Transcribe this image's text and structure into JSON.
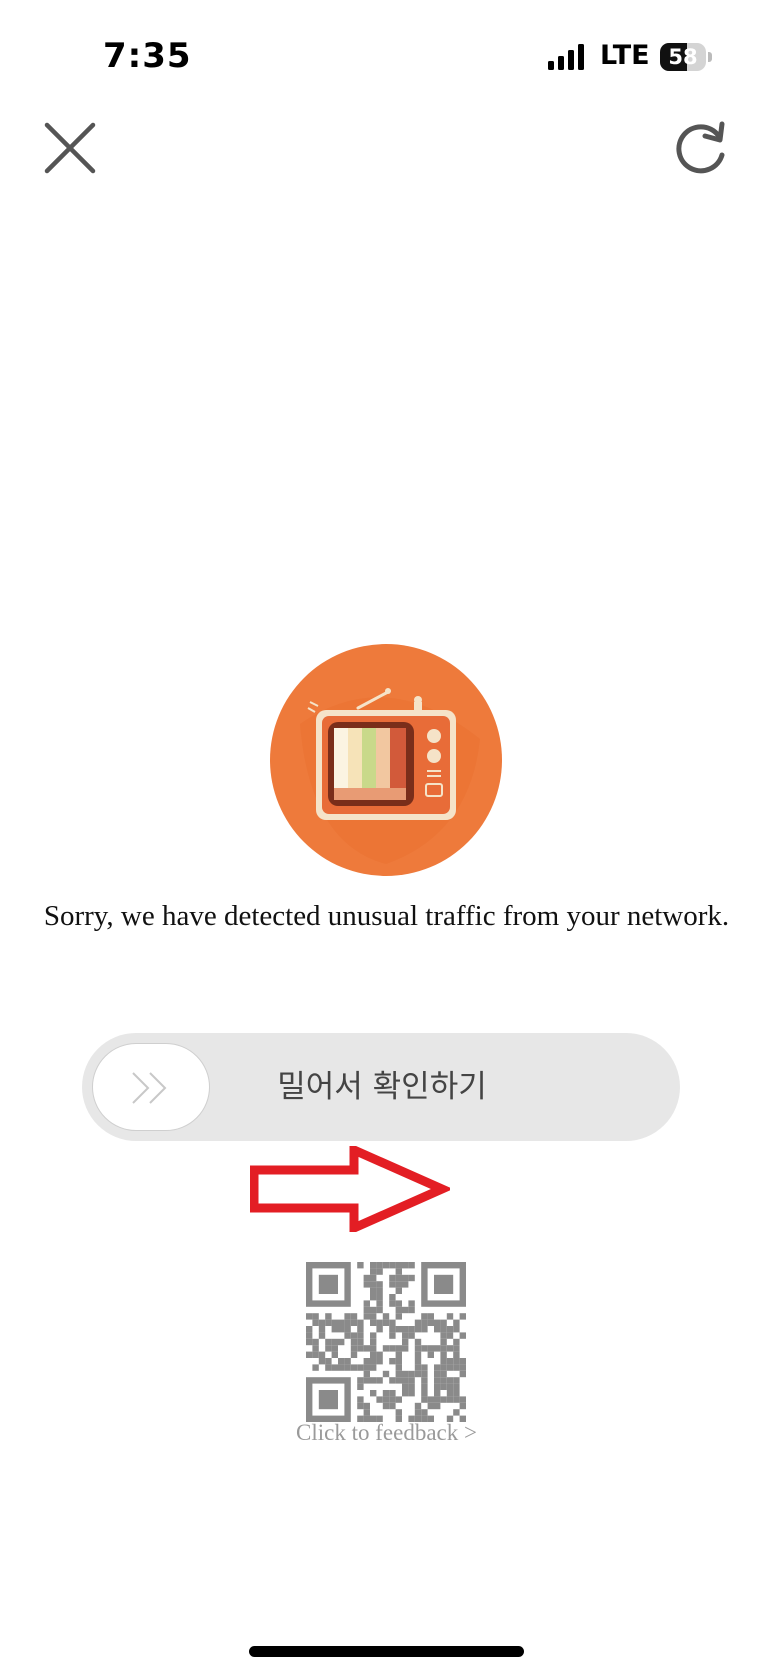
{
  "status_bar": {
    "time": "7:35",
    "network": "LTE",
    "battery_percent": "58",
    "battery_level": 0.58
  },
  "toolbar": {
    "close_icon": "close-icon",
    "reload_icon": "reload-icon"
  },
  "main": {
    "logo_icon": "tv-icon",
    "message": "Sorry, we have detected unusual traffic from your network.",
    "slider": {
      "label": "밀어서 확인하기",
      "handle_icon": "double-chevron-right-icon"
    },
    "annotation_icon": "red-arrow-right-icon",
    "qr_icon": "qr-code-icon",
    "feedback_link": "Click to feedback >"
  },
  "colors": {
    "accent_orange": "#EE7A3B",
    "annotation_red": "#E31E24",
    "slider_track": "#E7E7E7"
  }
}
